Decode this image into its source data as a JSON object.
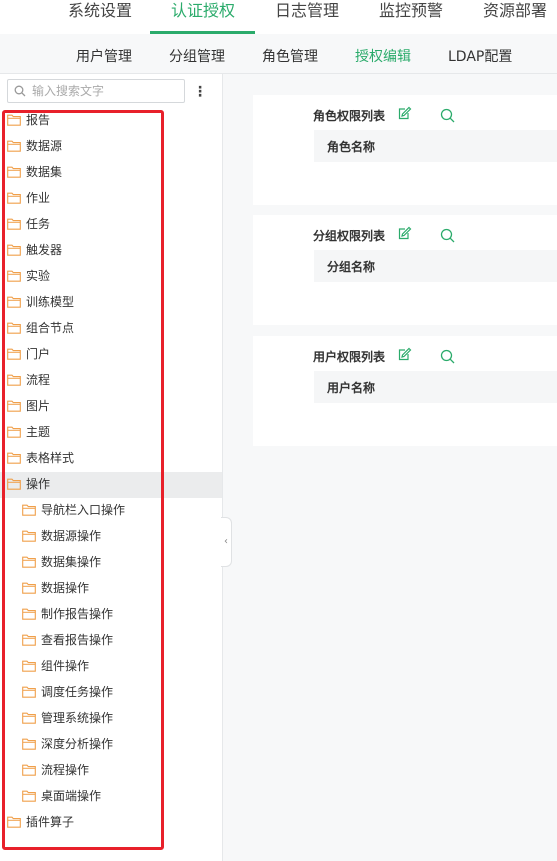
{
  "top_nav": {
    "tabs": [
      "系统设置",
      "认证授权",
      "日志管理",
      "监控预警",
      "资源部署"
    ],
    "active_index": 1
  },
  "sub_nav": {
    "tabs": [
      "用户管理",
      "分组管理",
      "角色管理",
      "授权编辑",
      "LDAP配置"
    ],
    "active_index": 3
  },
  "search": {
    "placeholder": "输入搜索文字"
  },
  "tree": [
    {
      "label": "报告",
      "level": 0
    },
    {
      "label": "数据源",
      "level": 0
    },
    {
      "label": "数据集",
      "level": 0
    },
    {
      "label": "作业",
      "level": 0
    },
    {
      "label": "任务",
      "level": 0
    },
    {
      "label": "触发器",
      "level": 0
    },
    {
      "label": "实验",
      "level": 0
    },
    {
      "label": "训练模型",
      "level": 0
    },
    {
      "label": "组合节点",
      "level": 0
    },
    {
      "label": "门户",
      "level": 0
    },
    {
      "label": "流程",
      "level": 0
    },
    {
      "label": "图片",
      "level": 0
    },
    {
      "label": "主题",
      "level": 0
    },
    {
      "label": "表格样式",
      "level": 0
    },
    {
      "label": "操作",
      "level": 0,
      "selected": true
    },
    {
      "label": "导航栏入口操作",
      "level": 1
    },
    {
      "label": "数据源操作",
      "level": 1
    },
    {
      "label": "数据集操作",
      "level": 1
    },
    {
      "label": "数据操作",
      "level": 1
    },
    {
      "label": "制作报告操作",
      "level": 1
    },
    {
      "label": "查看报告操作",
      "level": 1
    },
    {
      "label": "组件操作",
      "level": 1
    },
    {
      "label": "调度任务操作",
      "level": 1
    },
    {
      "label": "管理系统操作",
      "level": 1
    },
    {
      "label": "深度分析操作",
      "level": 1
    },
    {
      "label": "流程操作",
      "level": 1
    },
    {
      "label": "桌面端操作",
      "level": 1
    },
    {
      "label": "插件算子",
      "level": 0
    }
  ],
  "panels": {
    "role": {
      "title": "角色权限列表",
      "column": "角色名称"
    },
    "group": {
      "title": "分组权限列表",
      "column": "分组名称"
    },
    "user": {
      "title": "用户权限列表",
      "column": "用户名称"
    }
  },
  "colors": {
    "accent": "#2bab6b",
    "folder": "#f0a04b",
    "highlight_border": "#e8202a"
  },
  "icons": {
    "search": "search-icon",
    "more": "more-vertical-icon",
    "folder": "folder-icon",
    "edit": "edit-icon",
    "zoom": "zoom-icon",
    "collapse": "chevron-left-icon"
  }
}
